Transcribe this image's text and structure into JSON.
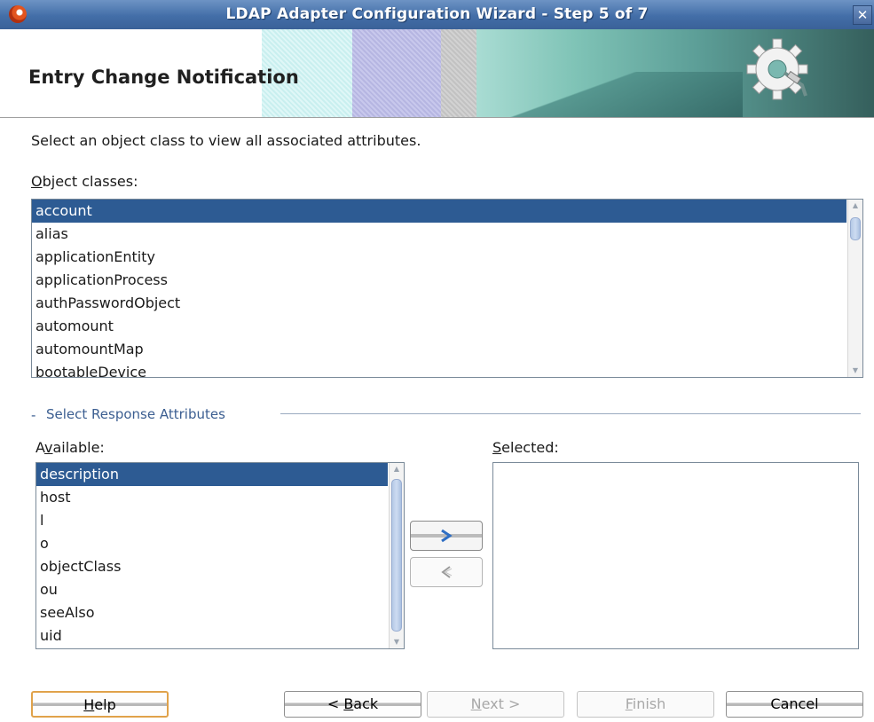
{
  "window": {
    "title": "LDAP Adapter Configuration Wizard - Step 5 of 7",
    "close_glyph": "✕",
    "app_icon": "oracle-icon"
  },
  "header": {
    "title": "Entry Change Notification",
    "banner_icon": "gear-plug-icon"
  },
  "instruction": "Select an object class to view all associated attributes.",
  "object_classes": {
    "label_mnemonic": "O",
    "label_rest": "bject classes:",
    "items": [
      "account",
      "alias",
      "applicationEntity",
      "applicationProcess",
      "authPasswordObject",
      "automount",
      "automountMap",
      "bootableDevice"
    ],
    "selected": "account"
  },
  "response_attributes": {
    "group_dash": "-",
    "group_title": "Select Response Attributes",
    "available": {
      "label_pre": "A",
      "label_mnemonic": "v",
      "label_rest": "ailable:",
      "items": [
        "description",
        "host",
        "l",
        "o",
        "objectClass",
        "ou",
        "seeAlso",
        "uid"
      ],
      "selected": "description"
    },
    "selected_list": {
      "label_mnemonic": "S",
      "label_rest": "elected:",
      "items": []
    },
    "add_icon": "chevron-right-icon",
    "remove_icon": "chevron-left-icon"
  },
  "buttons": {
    "help": {
      "mnemonic": "H",
      "rest": "elp"
    },
    "back": {
      "pre": "< ",
      "mnemonic": "B",
      "rest": "ack"
    },
    "next": {
      "mnemonic": "N",
      "rest": "ext >"
    },
    "finish": {
      "mnemonic": "F",
      "rest": "inish"
    },
    "cancel": {
      "label": "Cancel"
    }
  },
  "colors": {
    "title_bar": "#436ea8",
    "selection": "#2d5b93",
    "group_title": "#3b5e91",
    "help_focus": "#e0a24a"
  }
}
